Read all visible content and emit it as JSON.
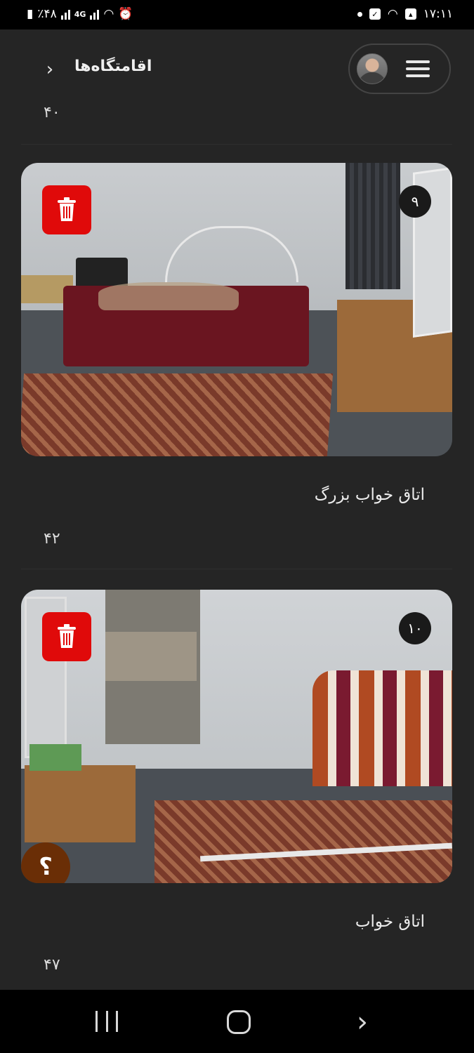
{
  "status_bar": {
    "battery": "٪۴۸",
    "network": "4G",
    "time": "۱۷:۱۱"
  },
  "header": {
    "title": "اقامتگاه‌ها",
    "back_icon": "chevron-right-icon",
    "menu_icon": "hamburger-menu-icon",
    "avatar": "user-avatar"
  },
  "content": {
    "top_number": "۴۰",
    "items": [
      {
        "badge": "۹",
        "title": "اتاق خواب بزرگ",
        "number": "۴۲",
        "delete_icon": "trash-icon"
      },
      {
        "badge": "۱۰",
        "title": "اتاق خواب",
        "number": "۴۷",
        "delete_icon": "trash-icon",
        "help_icon": "question-mark-icon",
        "help_label": "؟"
      }
    ]
  },
  "colors": {
    "background": "#252525",
    "delete_red": "#e00a0a",
    "help_brown": "#6a2e06"
  },
  "nav": {
    "recent_icon": "recent-apps-icon",
    "home_icon": "home-icon",
    "back_icon": "back-icon"
  }
}
